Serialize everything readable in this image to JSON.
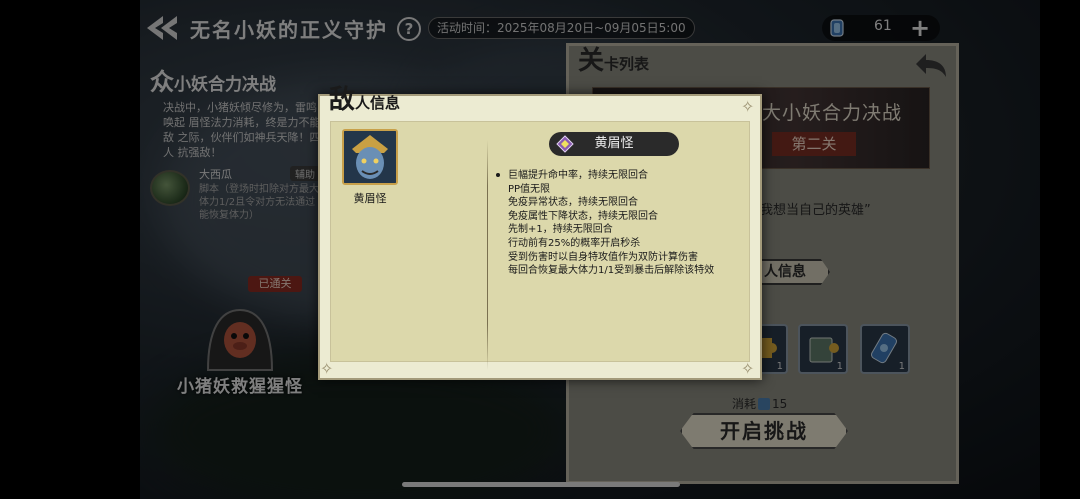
{
  "header": {
    "title": "无名小妖的正义守护",
    "help_label": "?",
    "activity_time": "活动时间：2025年08月20日~09月05日5:00",
    "currency_value": "61",
    "add_label": "+"
  },
  "left": {
    "section_title_big": "众",
    "section_title_rest": "小妖合力决战",
    "description": "决战中，小猪妖倾尽修为，雷鸣唤起 眉怪法力消耗，终是力不能敌 之际，伙伴们如神兵天降！四人 抗强敌！",
    "melon_name": "大西瓜",
    "melon_tag": "辅助",
    "melon_desc": "脚本（登场时扣除对方最大 体力1/2且令对方无法通过 能恢复体力）",
    "cleared_label": "已通关",
    "stage_name": "小猪妖救猩猩怪"
  },
  "stage_panel": {
    "title_big": "关",
    "title_rest": "卡列表",
    "banner_title": "大小妖合力决战",
    "banner_stage": "第二关",
    "quote": "我想当自己的英雄”",
    "enemy_info_label": "人信息",
    "rewards": [
      {
        "icon": "puzzle-piece-icon",
        "count": "1"
      },
      {
        "icon": "card-puzzle-icon",
        "count": "1"
      },
      {
        "icon": "gem-scroll-icon",
        "count": "1"
      }
    ],
    "cost_label": "消耗",
    "cost_value": "15",
    "start_label": "开启挑战"
  },
  "modal": {
    "title_big": "敌",
    "title_rest": "人信息",
    "avatar_name": "黄眉怪",
    "enemy_name": "黄眉怪",
    "traits": [
      "巨幅提升命中率，持续无限回合",
      "PP值无限",
      "免疫异常状态，持续无限回合",
      "免疫属性下降状态，持续无限回合",
      "先制+1，持续无限回合",
      "行动前有25%的概率开启秒杀",
      "受到伤害时以自身特攻值作为双防计算伤害",
      "每回合恢复最大体力1/1受到暴击后解除该特效"
    ]
  }
}
